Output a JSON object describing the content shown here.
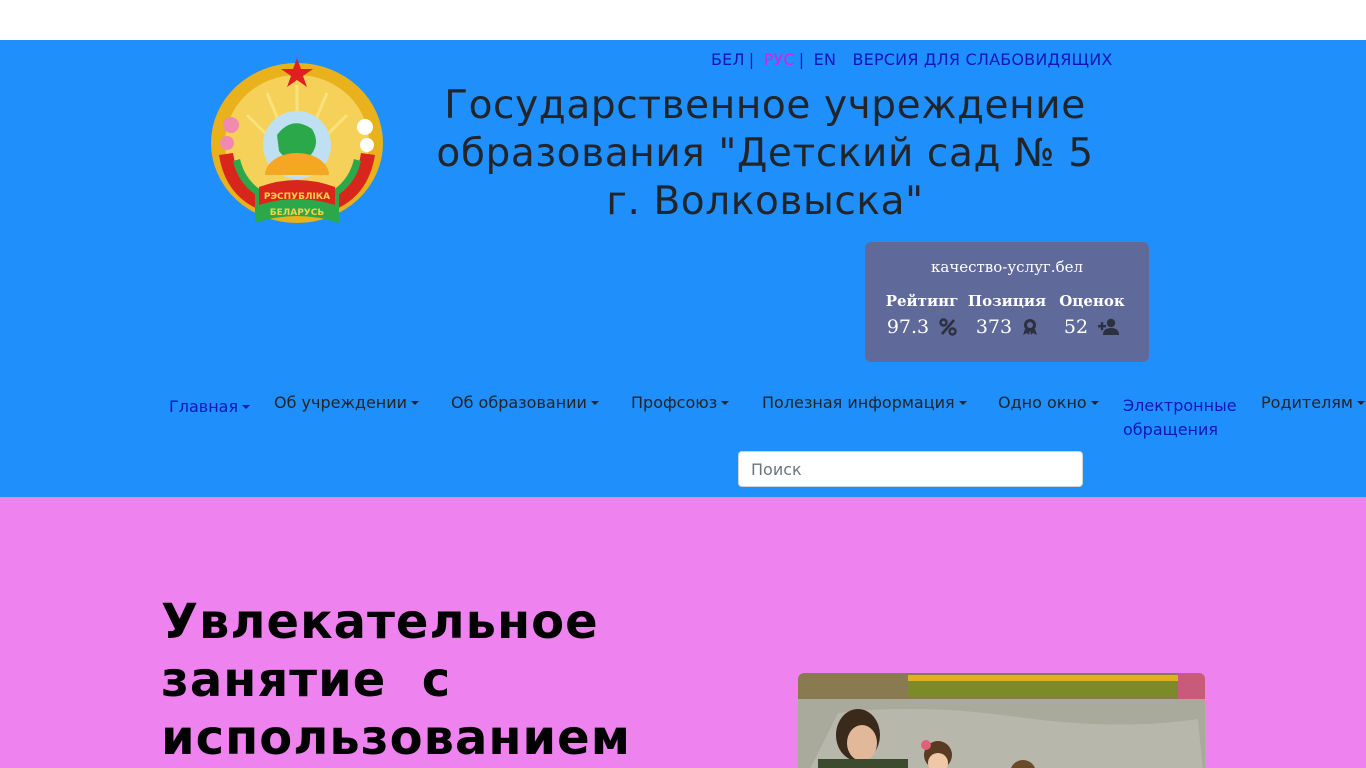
{
  "header": {
    "languages": [
      {
        "label": "БЕЛ",
        "active": false
      },
      {
        "label": "РУС",
        "active": true
      },
      {
        "label": "EN",
        "active": false
      }
    ],
    "separator": "|",
    "vision_label": "ВЕРСИЯ ДЛЯ СЛАБОВИДЯЩИХ",
    "title": "Государственное учреждение образования \"Детский сад № 5 г. Волковыска\"",
    "emblem_text": [
      "РЭСПУБЛІКА",
      "БЕЛАРУСЬ"
    ]
  },
  "rating": {
    "site": "качество-услуг.бел",
    "items": [
      {
        "label": "Рейтинг",
        "value": "97.3",
        "icon": "percent-icon"
      },
      {
        "label": "Позиция",
        "value": "373",
        "icon": "award-icon"
      },
      {
        "label": "Оценок",
        "value": "52",
        "icon": "user-plus-icon"
      }
    ]
  },
  "nav": {
    "items": [
      {
        "label": "Главная",
        "dropdown": true,
        "active": true
      },
      {
        "label": "Об учреждении",
        "dropdown": true
      },
      {
        "label": "Об образовании",
        "dropdown": true
      },
      {
        "label": "Профсоюз",
        "dropdown": true
      },
      {
        "label": "Полезная информация",
        "dropdown": true
      },
      {
        "label": "Одно окно",
        "dropdown": true
      },
      {
        "label": "Электронные обращения",
        "dropdown": false
      },
      {
        "label": "Родителям",
        "dropdown": true
      }
    ]
  },
  "search": {
    "placeholder": "Поиск"
  },
  "hero": {
    "title": "Увлекательное занятие  с использованием"
  },
  "colors": {
    "header_bg": "#1f8ffc",
    "hero_bg": "#ee82ee",
    "rating_bg": "#5f6a9a",
    "link": "#1414b8",
    "active_lang": "#e01de3"
  }
}
